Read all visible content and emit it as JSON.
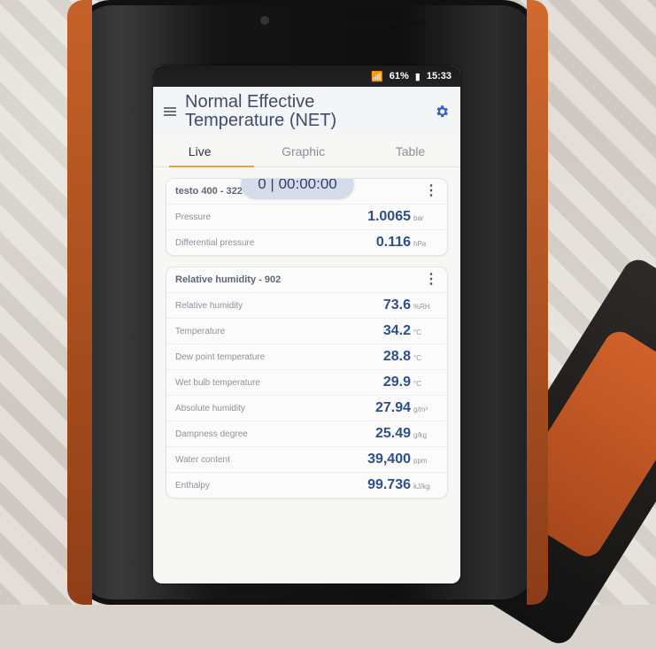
{
  "status": {
    "wifi_icon": "wifi-icon",
    "battery_percent": "61%",
    "battery_icon": "battery-icon",
    "time": "15:33"
  },
  "appbar": {
    "menu_icon": "menu-icon",
    "title": "Normal Effective Temperature (NET)",
    "settings_icon": "gear-icon"
  },
  "tabs": [
    {
      "label": "Live"
    },
    {
      "label": "Graphic"
    },
    {
      "label": "Table"
    }
  ],
  "cards": [
    {
      "title": "testo 400 - 322",
      "timer": "0 | 00:00:00",
      "rows": [
        {
          "label": "Pressure",
          "value": "1.0065",
          "unit": "bar"
        },
        {
          "label": "Differential pressure",
          "value": "0.116",
          "unit": "hPa"
        }
      ]
    },
    {
      "title": "Relative humidity - 902",
      "rows": [
        {
          "label": "Relative humidity",
          "value": "73.6",
          "unit": "%RH"
        },
        {
          "label": "Temperature",
          "value": "34.2",
          "unit": "°C"
        },
        {
          "label": "Dew point temperature",
          "value": "28.8",
          "unit": "°C"
        },
        {
          "label": "Wet bulb temperature",
          "value": "29.9",
          "unit": "°C"
        },
        {
          "label": "Absolute humidity",
          "value": "27.94",
          "unit": "g/m³"
        },
        {
          "label": "Dampness degree",
          "value": "25.49",
          "unit": "g/kg"
        },
        {
          "label": "Water content",
          "value": "39,400",
          "unit": "ppm"
        },
        {
          "label": "Enthalpy",
          "value": "99.736",
          "unit": "kJ/kg"
        }
      ]
    }
  ]
}
